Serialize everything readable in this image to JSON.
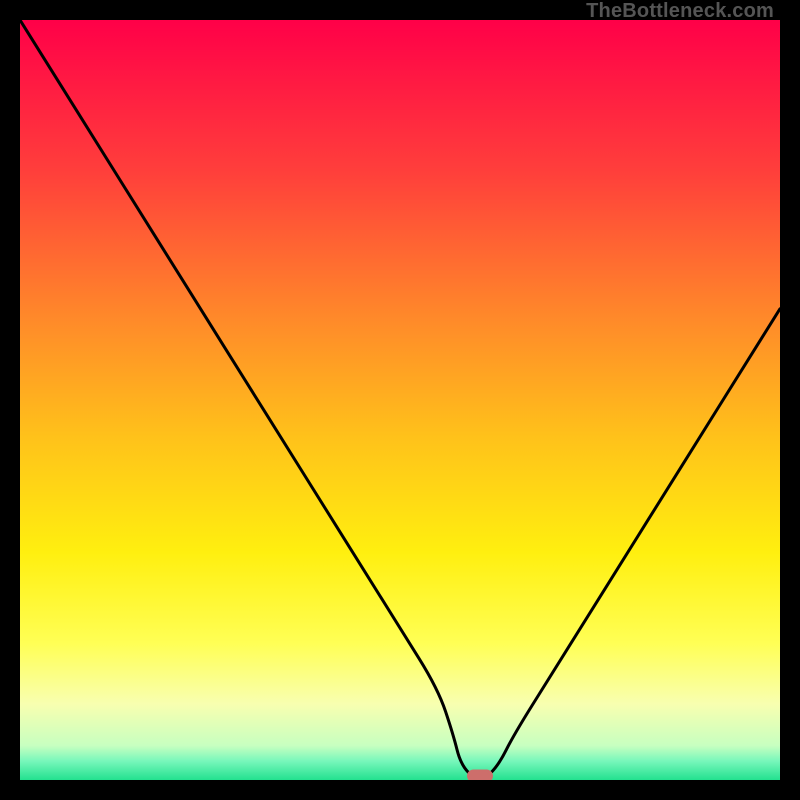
{
  "watermark": {
    "text": "TheBottleneck.com"
  },
  "chart_data": {
    "type": "line",
    "title": "",
    "xlabel": "",
    "ylabel": "",
    "xlim": [
      0,
      100
    ],
    "ylim": [
      0,
      100
    ],
    "gradient_stops": [
      {
        "offset": 0,
        "color": "#ff0048"
      },
      {
        "offset": 20,
        "color": "#ff3f3b"
      },
      {
        "offset": 40,
        "color": "#ff8c29"
      },
      {
        "offset": 55,
        "color": "#ffc21a"
      },
      {
        "offset": 70,
        "color": "#ffef0f"
      },
      {
        "offset": 82,
        "color": "#ffff55"
      },
      {
        "offset": 90,
        "color": "#f8ffb0"
      },
      {
        "offset": 95.5,
        "color": "#c7ffc0"
      },
      {
        "offset": 97.5,
        "color": "#78f7bb"
      },
      {
        "offset": 100,
        "color": "#23e18f"
      }
    ],
    "series": [
      {
        "name": "bottleneck-curve",
        "x": [
          0,
          5,
          10,
          15,
          20,
          25,
          30,
          35,
          40,
          45,
          50,
          55,
          57,
          58,
          60,
          61,
          63,
          65,
          70,
          75,
          80,
          85,
          90,
          95,
          100
        ],
        "values": [
          100,
          92,
          84,
          76,
          68,
          60,
          52,
          44,
          36,
          28,
          20,
          12,
          6,
          2,
          0,
          0,
          2,
          6,
          14,
          22,
          30,
          38,
          46,
          54,
          62
        ]
      }
    ],
    "marker": {
      "x": 60.5,
      "y": 0.5
    }
  }
}
